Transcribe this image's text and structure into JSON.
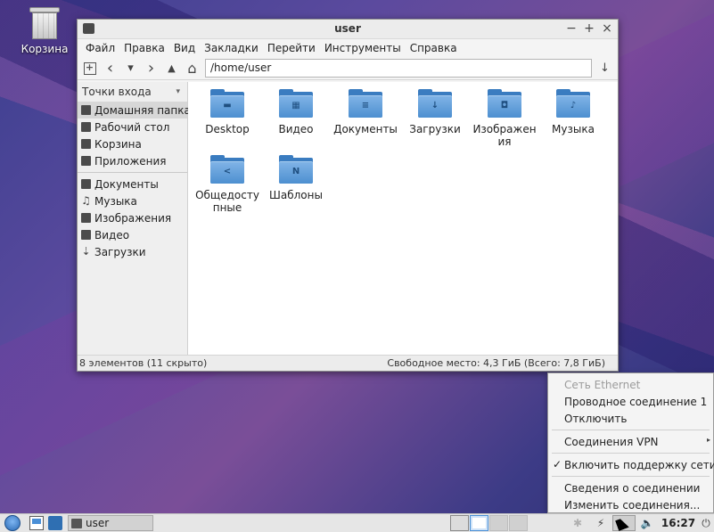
{
  "desktop": {
    "icons": [
      {
        "label": "Корзина",
        "icon": "trash-icon"
      }
    ]
  },
  "window": {
    "title": "user",
    "controls": {
      "minimize": "−",
      "maximize": "+",
      "close": "×"
    },
    "menu": [
      "Файл",
      "Правка",
      "Вид",
      "Закладки",
      "Перейти",
      "Инструменты",
      "Справка"
    ],
    "toolbar": {
      "new_tab": "+",
      "back": "‹",
      "history": "▾",
      "forward": "›",
      "up": "▲",
      "home": "⌂",
      "path": "/home/user",
      "go": "↓"
    },
    "sidebar": {
      "header": "Точки входа",
      "header_arrow": "▾",
      "places": [
        {
          "label": "Домашняя папка",
          "icon": "home-icon"
        },
        {
          "label": "Рабочий стол",
          "icon": "desktop-icon"
        },
        {
          "label": "Корзина",
          "icon": "trash-icon"
        },
        {
          "label": "Приложения",
          "icon": "applications-icon"
        }
      ],
      "bookmarks": [
        {
          "label": "Документы",
          "icon": "documents-icon"
        },
        {
          "label": "Музыка",
          "icon": "music-icon",
          "glyph": "♫"
        },
        {
          "label": "Изображения",
          "icon": "pictures-icon"
        },
        {
          "label": "Видео",
          "icon": "video-icon"
        },
        {
          "label": "Загрузки",
          "icon": "downloads-icon",
          "glyph": "⇣"
        }
      ]
    },
    "files": [
      {
        "name": "Desktop",
        "emblem": "▬"
      },
      {
        "name": "Видео",
        "emblem": "▦"
      },
      {
        "name": "Документы",
        "emblem": "≡"
      },
      {
        "name": "Загрузки",
        "emblem": "↓"
      },
      {
        "name": "Изображения",
        "emblem": "◘"
      },
      {
        "name": "Музыка",
        "emblem": "♪"
      },
      {
        "name": "Общедоступные",
        "emblem": "<"
      },
      {
        "name": "Шаблоны",
        "emblem": "N"
      }
    ],
    "status": {
      "left": "8 элементов (11 скрыто)",
      "right": "Свободное место: 4,3 ГиБ (Всего: 7,8 ГиБ)"
    }
  },
  "network_menu": {
    "section_title": "Сеть Ethernet",
    "items": {
      "wired": "Проводное соединение 1",
      "disconnect": "Отключить",
      "vpn": "Соединения VPN",
      "vpn_arrow": "▸",
      "enable_networking": "Включить поддержку сети",
      "enable_check": "✓",
      "connection_info": "Сведения о соединении",
      "edit_connections": "Изменить соединения..."
    }
  },
  "panel": {
    "task_label": "user",
    "tray": {
      "bluetooth": "✱",
      "power_manager": "⚡",
      "volume": "🔈",
      "clock": "16:27",
      "power_button": "⏻"
    }
  }
}
